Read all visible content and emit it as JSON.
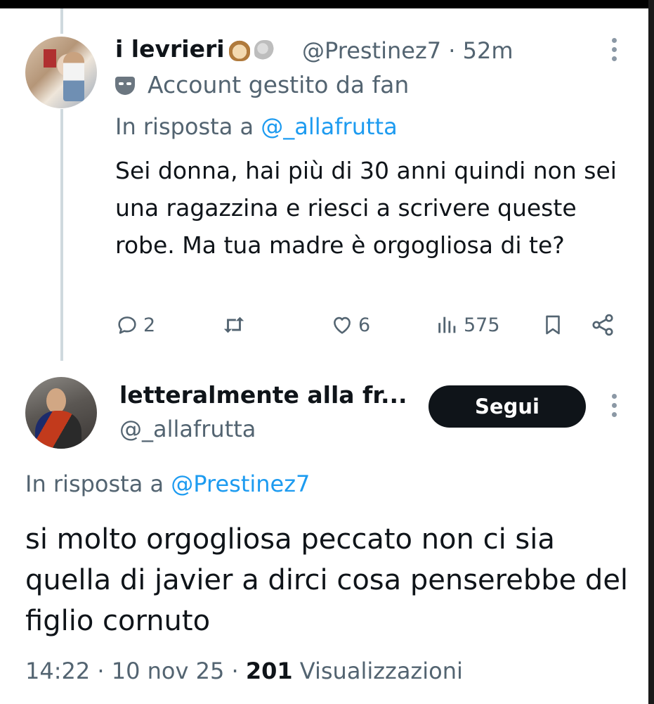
{
  "tweet_1": {
    "display_name": "i levrieri",
    "emojis": [
      "dog-emoji",
      "poodle-emoji"
    ],
    "handle": "@Prestinez7",
    "separator": "·",
    "time_ago": "52m",
    "account_label": "Account gestito da fan",
    "reply_prefix": "In risposta a",
    "reply_to": "@_allafrutta",
    "text": "Sei donna, hai più di 30 anni quindi non sei una ragazzina e riesci a scrivere queste robe. Ma tua madre è orgogliosa di te?",
    "actions": {
      "replies": "2",
      "reposts": "",
      "likes": "6",
      "views": "575"
    }
  },
  "tweet_2": {
    "display_name": "letteralmente alla fr...",
    "handle": "@_allafrutta",
    "follow_label": "Segui",
    "reply_prefix": "In risposta a",
    "reply_to": "@Prestinez7",
    "text": "si molto orgogliosa peccato non ci sia quella di javier a dirci cosa penserebbe del figlio cornuto",
    "time": "14:22",
    "date": "10 nov 25",
    "separator": "·",
    "views_count": "201",
    "views_label": "Visualizzazioni"
  },
  "colors": {
    "text_primary": "#0f1419",
    "text_secondary": "#536471",
    "link": "#1d9bf0",
    "follow_button_bg": "#0f1419",
    "thread_line": "#cfd9de"
  }
}
